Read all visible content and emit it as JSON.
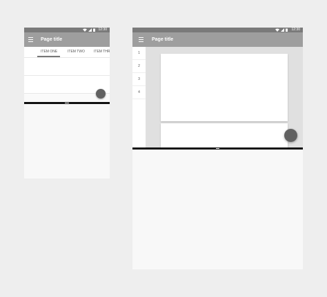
{
  "phone": {
    "status_time": "12:30",
    "title": "Page title",
    "tabs": [
      "ITEM ONE",
      "ITEM TWO",
      "ITEM THR"
    ]
  },
  "tablet": {
    "status_time": "12:30",
    "title": "Page title",
    "rail_items": [
      "1",
      "2",
      "3",
      "4"
    ]
  },
  "colors": {
    "status_bar": "#7a7a7a",
    "app_bar": "#9e9e9e",
    "fab": "#616161",
    "sheet_bar": "#111111"
  },
  "icons": [
    "menu-icon",
    "wifi-icon",
    "signal-icon",
    "battery-icon"
  ]
}
